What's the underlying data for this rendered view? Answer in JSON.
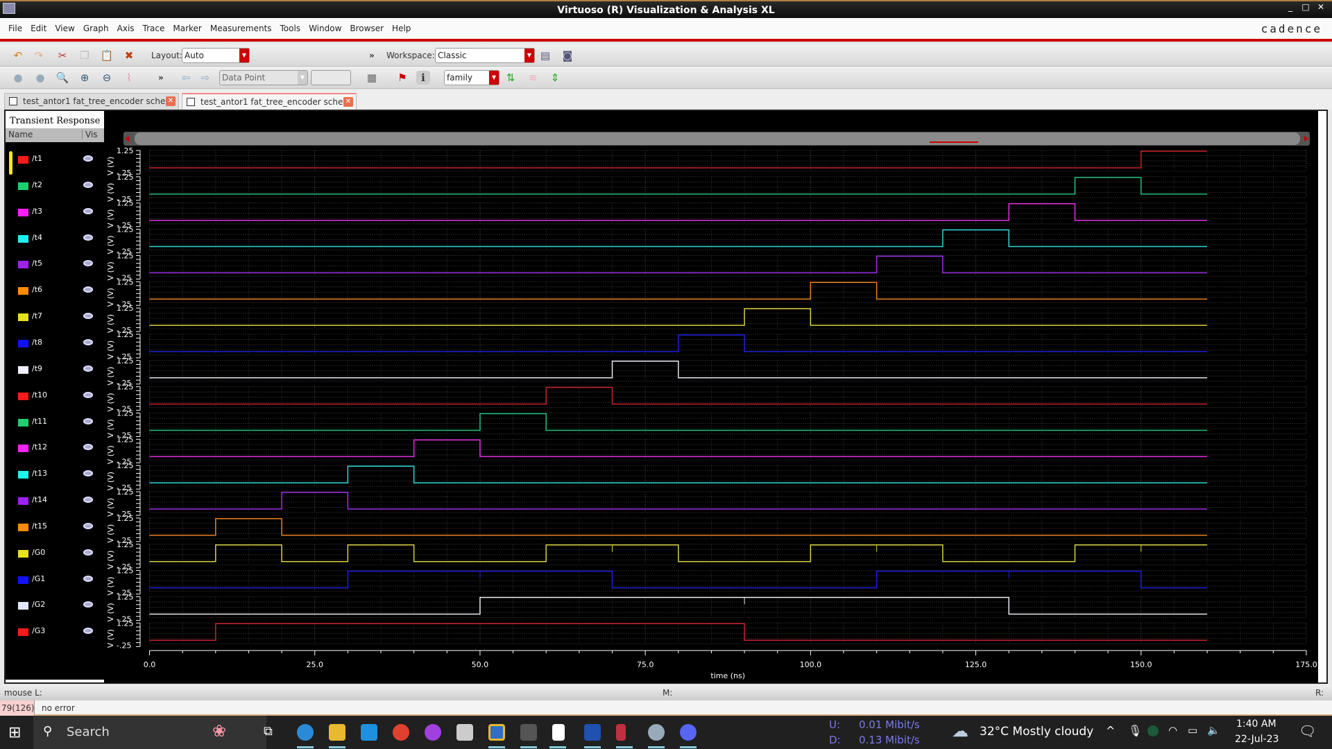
{
  "window": {
    "title": "Virtuoso (R) Visualization & Analysis XL",
    "brand": "cadence"
  },
  "menu": [
    "File",
    "Edit",
    "View",
    "Graph",
    "Axis",
    "Trace",
    "Marker",
    "Measurements",
    "Tools",
    "Window",
    "Browser",
    "Help"
  ],
  "toolbar": {
    "layout_label": "Layout:",
    "layout_value": "Auto",
    "workspace_label": "Workspace:",
    "workspace_value": "Classic",
    "data_point": "Data Point",
    "data_point_value": "",
    "family": "family",
    "overflow": "»"
  },
  "tabs": [
    {
      "label": "test_antor1 fat_tree_encoder sche...",
      "active": false
    },
    {
      "label": "test_antor1 fat_tree_encoder sche...",
      "active": true
    }
  ],
  "plot": {
    "title": "Transient Response",
    "legend_headers": {
      "name": "Name",
      "vis": "Vis"
    },
    "y_label": "V (V)",
    "y_top": "1.25",
    "y_bottom": "-.25"
  },
  "chart_data": {
    "type": "line",
    "xlabel": "time (ns)",
    "xlim": [
      0,
      175
    ],
    "x_ticks": [
      "0.0",
      "25.0",
      "50.0",
      "75.0",
      "100.0",
      "125.0",
      "150.0",
      "175.0"
    ],
    "sim_end": 160,
    "ylim": [
      -0.25,
      1.25
    ],
    "levels": {
      "low": 0,
      "high": 1.2
    },
    "grid": true,
    "series": [
      {
        "name": "/t1",
        "color": "#ff1a1a",
        "trace": "#c8202a",
        "high": [
          [
            150,
            160
          ]
        ]
      },
      {
        "name": "/t2",
        "color": "#1ed070",
        "trace": "#20c080",
        "high": [
          [
            140,
            150
          ]
        ]
      },
      {
        "name": "/t3",
        "color": "#ff20ff",
        "trace": "#e030e0",
        "high": [
          [
            130,
            140
          ]
        ]
      },
      {
        "name": "/t4",
        "color": "#20f0f0",
        "trace": "#30d8d8",
        "high": [
          [
            120,
            130
          ]
        ]
      },
      {
        "name": "/t5",
        "color": "#a020f0",
        "trace": "#a030e8",
        "high": [
          [
            110,
            120
          ]
        ]
      },
      {
        "name": "/t6",
        "color": "#ff8c00",
        "trace": "#e88020",
        "high": [
          [
            100,
            110
          ]
        ]
      },
      {
        "name": "/t7",
        "color": "#e8e020",
        "trace": "#d8d040",
        "high": [
          [
            90,
            100
          ]
        ]
      },
      {
        "name": "/t8",
        "color": "#1010ff",
        "trace": "#2020e0",
        "high": [
          [
            80,
            90
          ]
        ]
      },
      {
        "name": "/t9",
        "color": "#f0f0ff",
        "trace": "#e8e8f0",
        "high": [
          [
            70,
            80
          ]
        ]
      },
      {
        "name": "/t10",
        "color": "#ff1a1a",
        "trace": "#c8202a",
        "high": [
          [
            60,
            70
          ]
        ]
      },
      {
        "name": "/t11",
        "color": "#1ed070",
        "trace": "#20c080",
        "high": [
          [
            50,
            60
          ]
        ]
      },
      {
        "name": "/t12",
        "color": "#ff20ff",
        "trace": "#e030e0",
        "high": [
          [
            40,
            50
          ]
        ]
      },
      {
        "name": "/t13",
        "color": "#20f0f0",
        "trace": "#30d8d8",
        "high": [
          [
            30,
            40
          ]
        ]
      },
      {
        "name": "/t14",
        "color": "#a020f0",
        "trace": "#a030e8",
        "high": [
          [
            20,
            30
          ]
        ]
      },
      {
        "name": "/t15",
        "color": "#ff8c00",
        "trace": "#e88020",
        "high": [
          [
            10,
            20
          ]
        ]
      },
      {
        "name": "/G0",
        "color": "#e8e020",
        "trace": "#d8d040",
        "high": [
          [
            10,
            20
          ],
          [
            30,
            40
          ],
          [
            60,
            80
          ],
          [
            100,
            120
          ],
          [
            140,
            160
          ]
        ],
        "glitches": [
          70,
          110,
          150
        ]
      },
      {
        "name": "/G1",
        "color": "#1010ff",
        "trace": "#2020e0",
        "high": [
          [
            30,
            70
          ],
          [
            110,
            150
          ]
        ],
        "glitches": [
          50,
          130
        ]
      },
      {
        "name": "/G2",
        "color": "#e0e8ff",
        "trace": "#e8e8f0",
        "high": [
          [
            50,
            130
          ]
        ],
        "glitches": [
          90
        ]
      },
      {
        "name": "/G3",
        "color": "#ff1a1a",
        "trace": "#c8202a",
        "high": [
          [
            10,
            90
          ]
        ]
      }
    ]
  },
  "status": {
    "mouse_l": "mouse L:",
    "m": "M:",
    "r": "R:",
    "count": "79(126)",
    "message": "no error"
  },
  "taskbar": {
    "search": "Search",
    "upload": "U:",
    "upload_rate": "0.01 Mibit/s",
    "download": "D:",
    "download_rate": "0.13 Mibit/s",
    "weather": "32°C  Mostly cloudy",
    "time": "1:40 AM",
    "date": "22-Jul-23"
  }
}
